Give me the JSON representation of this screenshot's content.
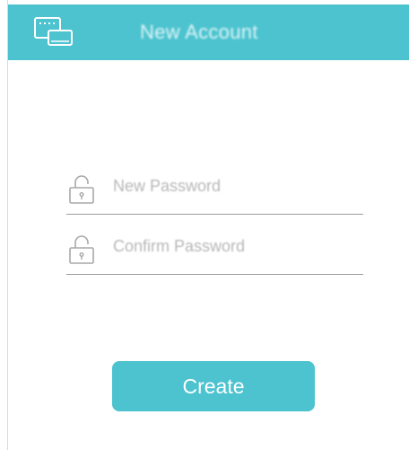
{
  "header": {
    "title": "New Account",
    "icon": "devices-icon",
    "background_color": "#4cc3cf"
  },
  "form": {
    "new_password": {
      "placeholder": "New Password",
      "value": "",
      "icon": "lock-icon"
    },
    "confirm_password": {
      "placeholder": "Confirm Password",
      "value": "",
      "icon": "lock-icon"
    },
    "create_label": "Create"
  },
  "colors": {
    "accent": "#4cc3cf",
    "divider": "#9d9d9d",
    "placeholder": "#b7b7b7"
  }
}
